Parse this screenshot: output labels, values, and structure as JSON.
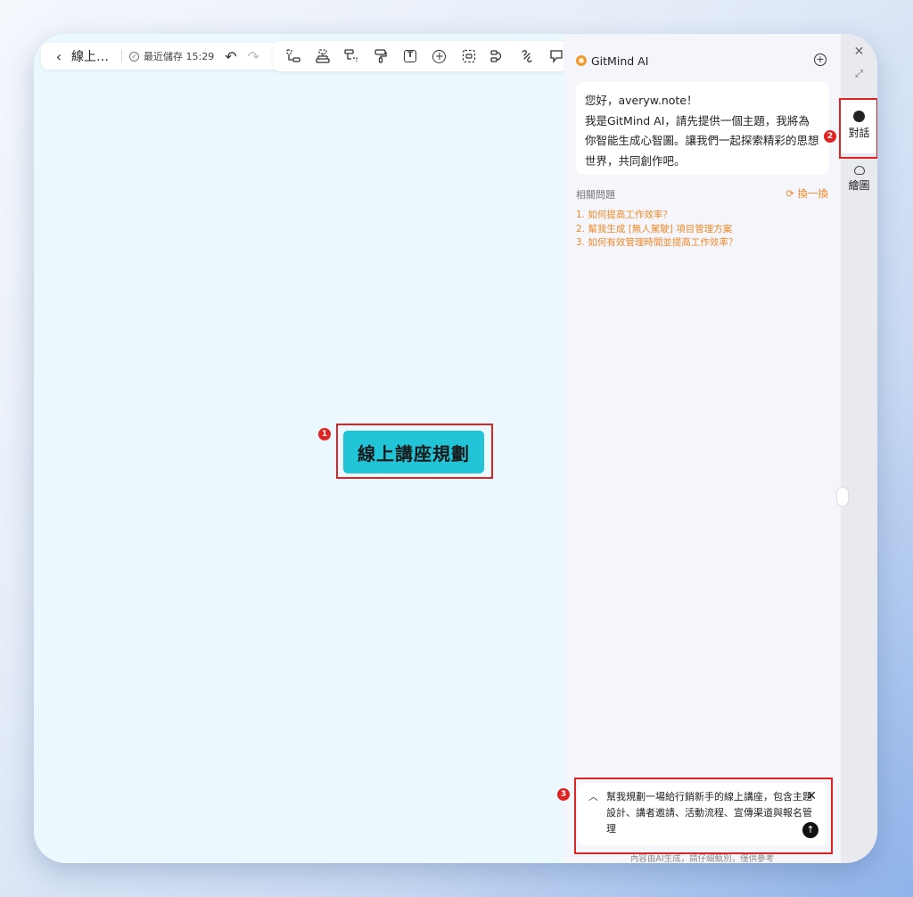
{
  "toolbar": {
    "back_label": "‹",
    "doc_title": "線上…",
    "save_status": "最近儲存 15:29",
    "undo_label": "↶",
    "redo_label": "↷",
    "tools": [
      "add-child-icon",
      "add-sibling-icon",
      "summary-icon",
      "format-brush-icon",
      "text-icon",
      "insert-icon",
      "frame-icon",
      "relation-icon",
      "link-icon",
      "comment-icon"
    ]
  },
  "canvas": {
    "root_node": "線上講座規劃"
  },
  "annotations": {
    "badge1": "1",
    "badge2": "2",
    "badge3": "3"
  },
  "panel": {
    "title": "GitMind AI",
    "greeting_line1": "您好，averyw.note！",
    "greeting_line2": "我是GitMind AI，請先提供一個主題，我將為你智能生成心智圖。讓我們一起探索精彩的思想世界，共同創作吧。",
    "related_title": "相關問題",
    "refresh_label": "換一換",
    "questions": [
      "1. 如何提高工作效率？",
      "2. 幫我生成 [無人駕駛] 項目管理方案",
      "3. 如何有效管理時間並提高工作效率？"
    ],
    "input_text": "幫我規劃一場給行銷新手的線上講座，包含主題設計、講者邀請、活動流程、宣傳渠道與報名管理",
    "disclaimer": "內容由AI生成，請仔細甄別，僅供參考"
  },
  "rail": {
    "chat_label": "對話",
    "draw_label": "繪圖"
  },
  "colors": {
    "node": "#22c4d8",
    "accent": "#f08a2c",
    "annotation": "#e02424"
  }
}
